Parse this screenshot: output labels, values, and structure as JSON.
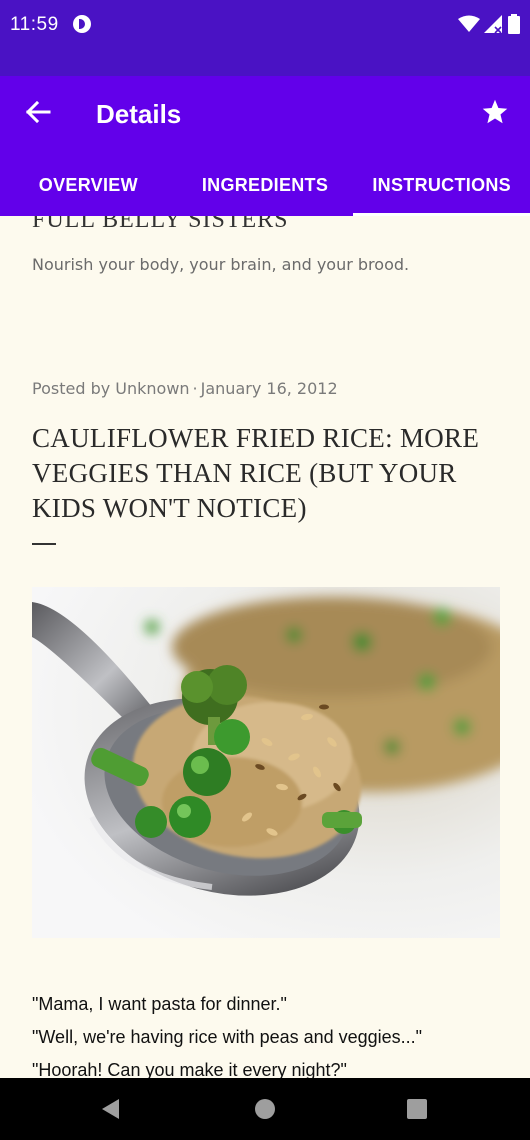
{
  "status_bar": {
    "time": "11:59",
    "background": "#4a12c4",
    "icons": [
      "app-notification-icon",
      "wifi-icon",
      "signal-icon",
      "battery-icon"
    ]
  },
  "app_bar": {
    "title": "Details",
    "background": "#6200ea",
    "back_icon": "arrow-back-icon",
    "favorite_icon": "star-icon"
  },
  "tabs": [
    {
      "label": "OVERVIEW",
      "active": false
    },
    {
      "label": "INGREDIENTS",
      "active": false
    },
    {
      "label": "INSTRUCTIONS",
      "active": true
    }
  ],
  "article": {
    "blog_name": "FULL BELLY SISTERS",
    "tagline": "Nourish your body, your brain, and your brood.",
    "posted_by": "Posted by Unknown",
    "separator": "·",
    "date": "January 16, 2012",
    "title": "CAULIFLOWER FRIED RICE: MORE VEGGIES THAN RICE (BUT YOUR KIDS WON'T NOTICE)",
    "image_icon": "cauliflower-fried-rice-photo",
    "dialogue": [
      "\"Mama, I want pasta for dinner.\"",
      "\"Well, we're having rice with peas and veggies...\"",
      "\"Hoorah! Can you make it every night?\""
    ]
  },
  "nav_bar": {
    "icons": [
      "nav-back-icon",
      "nav-home-icon",
      "nav-recents-icon"
    ]
  }
}
